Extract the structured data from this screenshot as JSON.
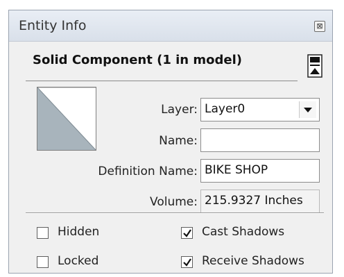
{
  "window": {
    "title": "Entity Info",
    "close_glyph": "⊠"
  },
  "entity": {
    "type_label": "Solid Component (1 in model)"
  },
  "fields": {
    "layer": {
      "label": "Layer:",
      "value": "Layer0"
    },
    "name": {
      "label": "Name:",
      "value": ""
    },
    "definition_name": {
      "label": "Definition Name:",
      "value": "BIKE SHOP"
    },
    "volume": {
      "label": "Volume:",
      "value": "215.9327 Inches"
    }
  },
  "options": {
    "hidden": {
      "label": "Hidden",
      "checked": false
    },
    "locked": {
      "label": "Locked",
      "checked": false
    },
    "cast_shadows": {
      "label": "Cast Shadows",
      "checked": true
    },
    "receive_shadows": {
      "label": "Receive Shadows",
      "checked": true
    }
  },
  "icons": {
    "close": "close-icon",
    "toggle": "panel-toggle-icon",
    "dropdown": "chevron-down-icon",
    "preview": "component-preview-thumbnail"
  },
  "colors": {
    "title_bg": "#dde4ee",
    "panel_bg": "#f0f0f0",
    "thumb_fill": "#a8b4bc"
  }
}
